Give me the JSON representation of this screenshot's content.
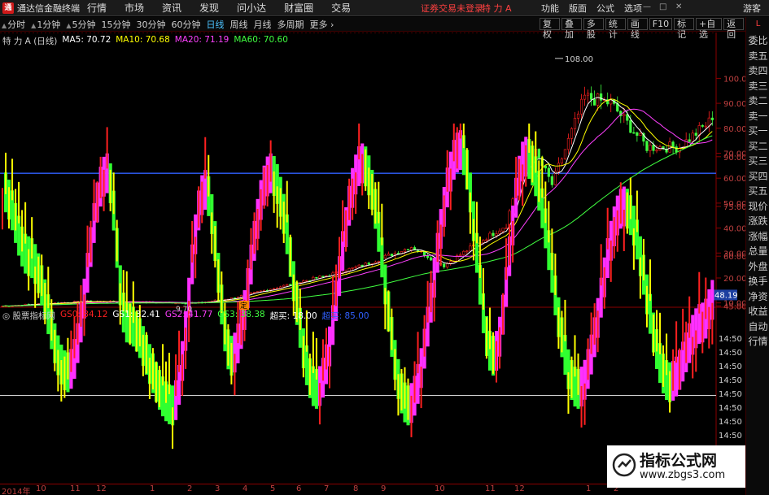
{
  "titlebar": {
    "logo_text": "通",
    "app_name": "通达信金融终端",
    "menus": [
      "行情",
      "市场",
      "资讯",
      "发现",
      "问小达",
      "财富圈",
      "交易"
    ],
    "login_warning": "证券交易未登录",
    "stock_name": "特 力 A",
    "right_menus": [
      "功能",
      "版面",
      "公式",
      "选项"
    ],
    "guest": "游客"
  },
  "periods": [
    {
      "label": "分时",
      "active": false
    },
    {
      "label": "1分钟",
      "active": false
    },
    {
      "label": "5分钟",
      "active": false
    },
    {
      "label": "15分钟",
      "active": false
    },
    {
      "label": "30分钟",
      "active": false
    },
    {
      "label": "60分钟",
      "active": false
    },
    {
      "label": "日线",
      "active": true
    },
    {
      "label": "周线",
      "active": false
    },
    {
      "label": "月线",
      "active": false
    },
    {
      "label": "多周期",
      "active": false
    },
    {
      "label": "更多",
      "active": false
    }
  ],
  "toolbuttons": [
    "复权",
    "叠加",
    "多股",
    "统计",
    "画线",
    "F10",
    "标记",
    "+自选",
    "返回"
  ],
  "main_legend": {
    "title": "特 力 A (日线)",
    "items": [
      {
        "label": "MA5: 70.72",
        "color": "#ffffff"
      },
      {
        "label": "MA10: 70.68",
        "color": "#ffff00"
      },
      {
        "label": "MA20: 71.19",
        "color": "#ff40ff"
      },
      {
        "label": "MA60: 70.60",
        "color": "#40ff40"
      }
    ]
  },
  "sub_legend": {
    "title": "股票指标网",
    "items": [
      {
        "label": "GS0: 34.12",
        "color": "#ff2020"
      },
      {
        "label": "GS1: 32.41",
        "color": "#ffffff"
      },
      {
        "label": "GS2: 41.77",
        "color": "#ff40ff"
      },
      {
        "label": "GS3: 38.38",
        "color": "#40ff40"
      },
      {
        "label": "超买: 18.00",
        "color": "#ffffff"
      },
      {
        "label": "超买: 85.00",
        "color": "#3060ff"
      }
    ]
  },
  "price_axis": [
    "100.0",
    "90.00",
    "80.00",
    "70.00",
    "60.00",
    "50.00",
    "40.00",
    "30.00",
    "20.00",
    "10.00"
  ],
  "sub_axis": [
    "90.00",
    "75.00",
    "60.00",
    "45.00"
  ],
  "sub_axis_extra": [
    "14:50",
    "14:50",
    "14:50",
    "14:50",
    "14:50",
    "14:50",
    "14:50",
    "14:50",
    "14:50",
    "14:50"
  ],
  "sub_current_value": "48.19",
  "annotations": {
    "high": "108.00",
    "low": "9.70",
    "marker": "定"
  },
  "x_axis": [
    "2014年",
    "10",
    "11",
    "12",
    "1",
    "2",
    "3",
    "4",
    "5",
    "6",
    "7",
    "8",
    "9",
    "10",
    "11",
    "12",
    "1",
    "2"
  ],
  "right_panel": [
    "L",
    "委比",
    "卖五",
    "卖四",
    "卖三",
    "卖二",
    "卖一",
    "买一",
    "买二",
    "买三",
    "买四",
    "买五",
    "现价",
    "涨跌",
    "涨幅",
    "总量",
    "外盘",
    "换手",
    "净资",
    "收益",
    "自动",
    "行情"
  ],
  "watermark": {
    "title": "指标公式网",
    "url": "www.zbgs3.com"
  },
  "colors": {
    "up": "#ff2020",
    "down": "#40ff40",
    "ma5": "#ffffff",
    "ma10": "#ffff00",
    "ma20": "#ff40ff",
    "ma60": "#40ff40",
    "grid": "#8b0000"
  }
}
